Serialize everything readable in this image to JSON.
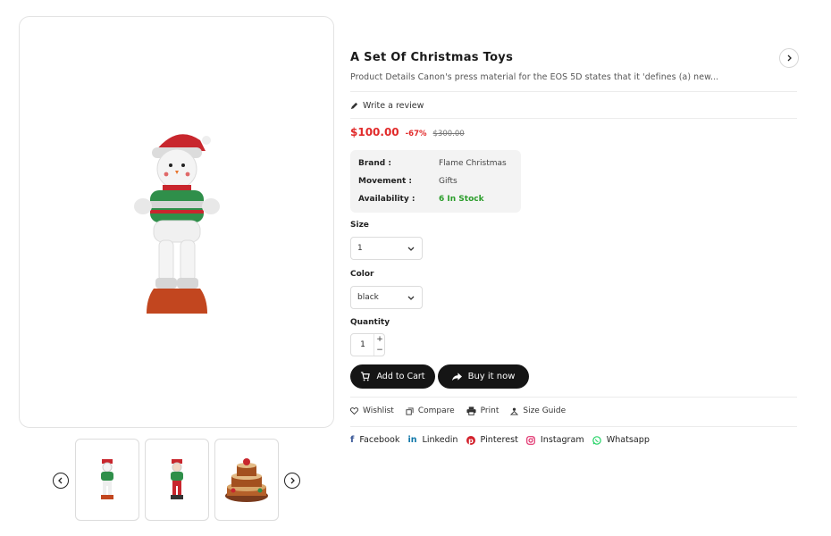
{
  "product": {
    "title": "A Set Of Christmas Toys",
    "description": "Product Details Canon's press material for the EOS 5D states that it 'defines (a) new...",
    "review_link": "Write a review",
    "price": "$100.00",
    "discount": "-67%",
    "old_price": "$300.00",
    "colors": {
      "price_red": "#e12a2a",
      "in_stock_green": "#2a9d2a",
      "button_dark": "#151515"
    }
  },
  "info": {
    "brand_label": "Brand :",
    "brand_value": "Flame Christmas",
    "movement_label": "Movement :",
    "movement_value": "Gifts",
    "availability_label": "Availability :",
    "availability_value": "6 In Stock"
  },
  "options": {
    "size_label": "Size",
    "size_value": "1",
    "color_label": "Color",
    "color_value": "black",
    "quantity_label": "Quantity",
    "quantity_value": "1",
    "plus": "+",
    "minus": "−"
  },
  "buttons": {
    "add_to_cart": "Add to Cart",
    "buy_now": "Buy it now"
  },
  "tools": {
    "wishlist": "Wishlist",
    "compare": "Compare",
    "print": "Print",
    "size_guide": "Size Guide"
  },
  "social": {
    "facebook": "Facebook",
    "linkedin": "Linkedin",
    "pinterest": "Pinterest",
    "instagram": "Instagram",
    "whatsapp": "Whatsapp"
  },
  "thumbnails": [
    "snowman-toy",
    "santa-toy",
    "christmas-cake"
  ]
}
